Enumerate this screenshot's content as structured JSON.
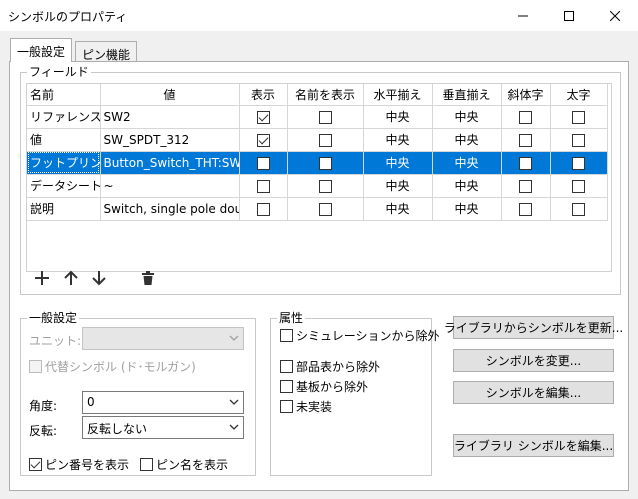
{
  "window": {
    "title": "シンボルのプロパティ"
  },
  "tabs": [
    {
      "label": "一般設定"
    },
    {
      "label": "ピン機能"
    }
  ],
  "fields_group": {
    "label": "フィールド"
  },
  "grid": {
    "headers": [
      "名前",
      "値",
      "表示",
      "名前を表示",
      "水平揃え",
      "垂直揃え",
      "斜体字",
      "太字"
    ],
    "rows": [
      {
        "name": "リファレンス",
        "value": "SW2",
        "show": true,
        "show_name": false,
        "h_align": "中央",
        "v_align": "中央",
        "italic": false,
        "bold": false
      },
      {
        "name": "値",
        "value": "SW_SPDT_312",
        "show": true,
        "show_name": false,
        "h_align": "中央",
        "v_align": "中央",
        "italic": false,
        "bold": false
      },
      {
        "name": "フットプリント",
        "value": "Button_Switch_THT:SW_XI",
        "show": false,
        "show_name": false,
        "h_align": "中央",
        "v_align": "中央",
        "italic": false,
        "bold": false,
        "selected": true
      },
      {
        "name": "データシート",
        "value": "~",
        "show": false,
        "show_name": false,
        "h_align": "中央",
        "v_align": "中央",
        "italic": false,
        "bold": false
      },
      {
        "name": "説明",
        "value": "Switch, single pole double",
        "show": false,
        "show_name": false,
        "h_align": "中央",
        "v_align": "中央",
        "italic": false,
        "bold": false
      }
    ]
  },
  "general": {
    "label": "一般設定",
    "unit_label": "ユニット:",
    "unit_value": "",
    "alt_symbol_label": "代替シンボル (ド･モルガン)",
    "angle_label": "角度:",
    "angle_value": "0",
    "mirror_label": "反転:",
    "mirror_value": "反転しない",
    "show_pin_numbers_label": "ピン番号を表示",
    "show_pin_numbers": true,
    "show_pin_names_label": "ピン名を表示",
    "show_pin_names": false
  },
  "attributes": {
    "label": "属性",
    "exclude_sim_label": "シミュレーションから除外",
    "exclude_bom_label": "部品表から除外",
    "exclude_board_label": "基板から除外",
    "dnp_label": "未実装"
  },
  "buttons": {
    "update_from_lib": "ライブラリからシンボルを更新...",
    "change_symbol": "シンボルを変更...",
    "edit_symbol": "シンボルを編集...",
    "edit_lib_symbol": "ライブラリ シンボルを編集..."
  }
}
